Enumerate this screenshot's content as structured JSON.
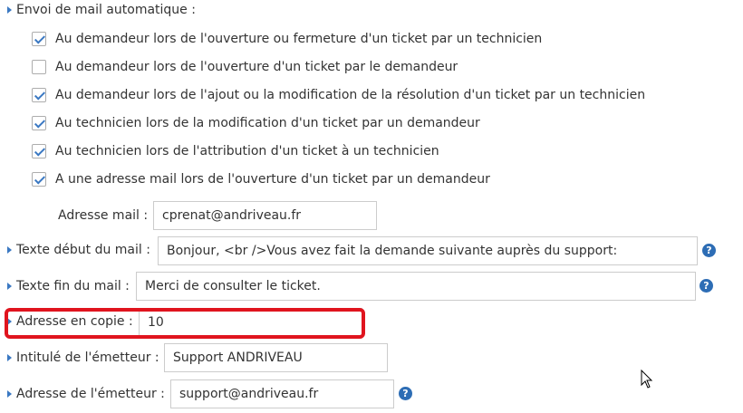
{
  "section": {
    "title": "Envoi de mail automatique :"
  },
  "checkboxes": [
    {
      "label": "Au demandeur lors de l'ouverture ou fermeture d'un ticket par un technicien",
      "checked": true
    },
    {
      "label": "Au demandeur lors de l'ouverture d'un ticket par le demandeur",
      "checked": false
    },
    {
      "label": "Au demandeur lors de l'ajout ou la modification de la résolution d'un ticket par un technicien",
      "checked": true
    },
    {
      "label": "Au technicien lors de la modification d'un ticket par un demandeur",
      "checked": true
    },
    {
      "label": "Au technicien lors de l'attribution d'un ticket à un technicien",
      "checked": true
    },
    {
      "label": "A une adresse mail lors de l'ouverture d'un ticket par un demandeur",
      "checked": true
    }
  ],
  "fields": {
    "adresse_mail": {
      "label": "Adresse mail :",
      "value": "cprenat@andriveau.fr"
    },
    "texte_debut": {
      "label": "Texte début du mail :",
      "value": "Bonjour, <br />Vous avez fait la demande suivante auprès du support:"
    },
    "texte_fin": {
      "label": "Texte fin du mail :",
      "value": "Merci de consulter le ticket."
    },
    "adresse_copie": {
      "label": "Adresse en copie :",
      "value": "10"
    },
    "intitule_emetteur": {
      "label": "Intitulé de l'émetteur :",
      "value": "Support ANDRIVEAU"
    },
    "adresse_emetteur": {
      "label": "Adresse de l'émetteur :",
      "value": "support@andriveau.fr"
    }
  },
  "help_glyph": "?",
  "colors": {
    "accent": "#3a78c2",
    "help": "#2d6db5",
    "highlight": "#e0141e"
  },
  "icons": [
    "caret-right-icon",
    "help-icon",
    "checkmark-icon",
    "mouse-cursor-icon"
  ]
}
